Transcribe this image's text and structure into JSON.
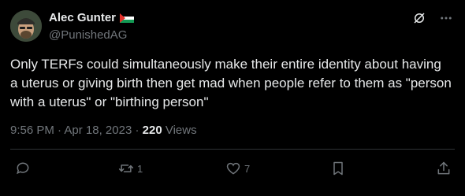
{
  "author": {
    "display_name": "Alec Gunter",
    "handle": "@PunishedAG",
    "flag_icon": "palestine-flag-icon"
  },
  "tweet": {
    "text": "Only TERFs could simultaneously make their entire identity about having a uterus or giving birth then get mad when people refer to them as \"person with a uterus\" or \"birthing person\""
  },
  "meta": {
    "time": "9:56 PM",
    "separator1": " · ",
    "date": "Apr 18, 2023",
    "separator2": " · ",
    "views_count": "220",
    "views_label": " Views"
  },
  "actions": {
    "reply_count": "",
    "retweet_count": "1",
    "like_count": "7",
    "bookmark_count": "",
    "share_count": ""
  },
  "colors": {
    "background": "#000000",
    "text_primary": "#e7e9ea",
    "text_secondary": "#71767b",
    "divider": "#2f3336"
  }
}
